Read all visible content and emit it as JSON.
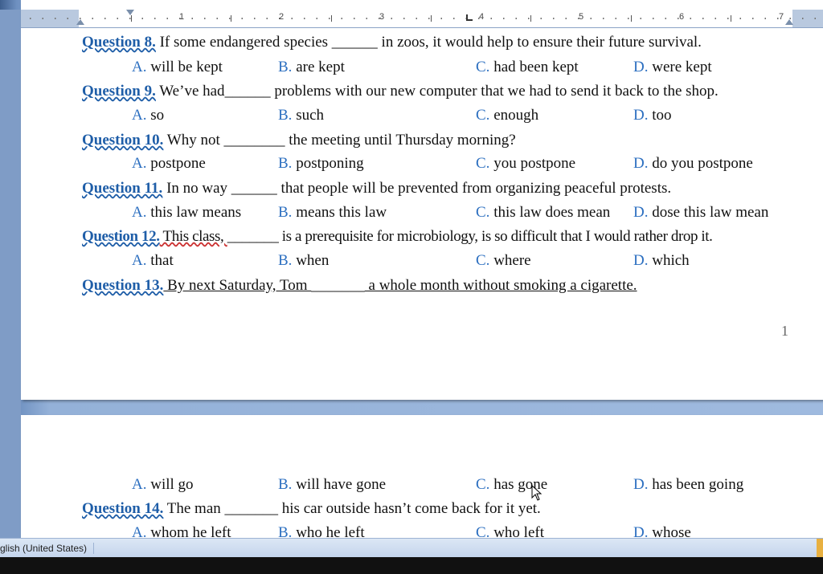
{
  "ruler": {
    "numbers": [
      "1",
      "2",
      "3",
      "4",
      "5",
      "6",
      "7"
    ]
  },
  "questions": [
    {
      "label": "Question 8.",
      "text_before": " If some endangered species ",
      "blank": "______",
      "text_after": " in zoos, it would help to ensure their future survival.",
      "options": [
        {
          "letter": "A.",
          "text": " will be kept"
        },
        {
          "letter": "B.",
          "text": " are kept"
        },
        {
          "letter": "C.",
          "text": " had been kept"
        },
        {
          "letter": "D.",
          "text": " were kept"
        }
      ]
    },
    {
      "label": "Question 9.",
      "text_before": " We’ve had",
      "blank": "______",
      "text_after": " problems with our new computer that we had to send it back to the shop.",
      "options": [
        {
          "letter": "A.",
          "text": " so"
        },
        {
          "letter": "B.",
          "text": " such"
        },
        {
          "letter": "C.",
          "text": " enough"
        },
        {
          "letter": "D.",
          "text": " too"
        }
      ]
    },
    {
      "label": "Question 10.",
      "text_before": " Why not ",
      "blank": "________",
      "text_after": " the meeting until Thursday morning?",
      "options": [
        {
          "letter": "A.",
          "text": " postpone"
        },
        {
          "letter": "B.",
          "text": " postponing"
        },
        {
          "letter": "C.",
          "text": " you postpone"
        },
        {
          "letter": "D.",
          "text": " do you postpone"
        }
      ]
    },
    {
      "label": "Question 11.",
      "text_before": " In no way ",
      "blank": "______",
      "text_after": " that people will be prevented from organizing peaceful protests.",
      "options": [
        {
          "letter": "A.",
          "text": " this law means"
        },
        {
          "letter": "B.",
          "text": " means this law"
        },
        {
          "letter": "C.",
          "text": " this law does mean"
        },
        {
          "letter": "D.",
          "text": " dose this law mean"
        }
      ]
    },
    {
      "label": "Question 12.",
      "text_before": " This class, ",
      "blank": "_______",
      "text_after": " is a prerequisite for microbiology, is so difficult that I would rather drop it.",
      "options": [
        {
          "letter": "A.",
          "text": " that"
        },
        {
          "letter": "B.",
          "text": " when"
        },
        {
          "letter": "C.",
          "text": " where"
        },
        {
          "letter": "D.",
          "text": " which"
        }
      ]
    },
    {
      "label": "Question 13.",
      "text_before": " By next Saturday, Tom ",
      "blank": "_______",
      "text_after": " a whole month without smoking a cigarette.",
      "options": [
        {
          "letter": "A.",
          "text": " will go"
        },
        {
          "letter": "B.",
          "text": " will have gone"
        },
        {
          "letter": "C.",
          "text": " has gone"
        },
        {
          "letter": "D.",
          "text": " has been going"
        }
      ]
    },
    {
      "label": "Question 14.",
      "text_before": " The man ",
      "blank": "_______",
      "text_after": " his car outside hasn’t come back for it yet.",
      "options": [
        {
          "letter": "A.",
          "text": " whom he left"
        },
        {
          "letter": "B.",
          "text": " who he left"
        },
        {
          "letter": "C.",
          "text": " who left"
        },
        {
          "letter": "D.",
          "text": " whose"
        }
      ]
    }
  ],
  "page_number": "1",
  "statusbar": {
    "language": "glish (United States)"
  }
}
